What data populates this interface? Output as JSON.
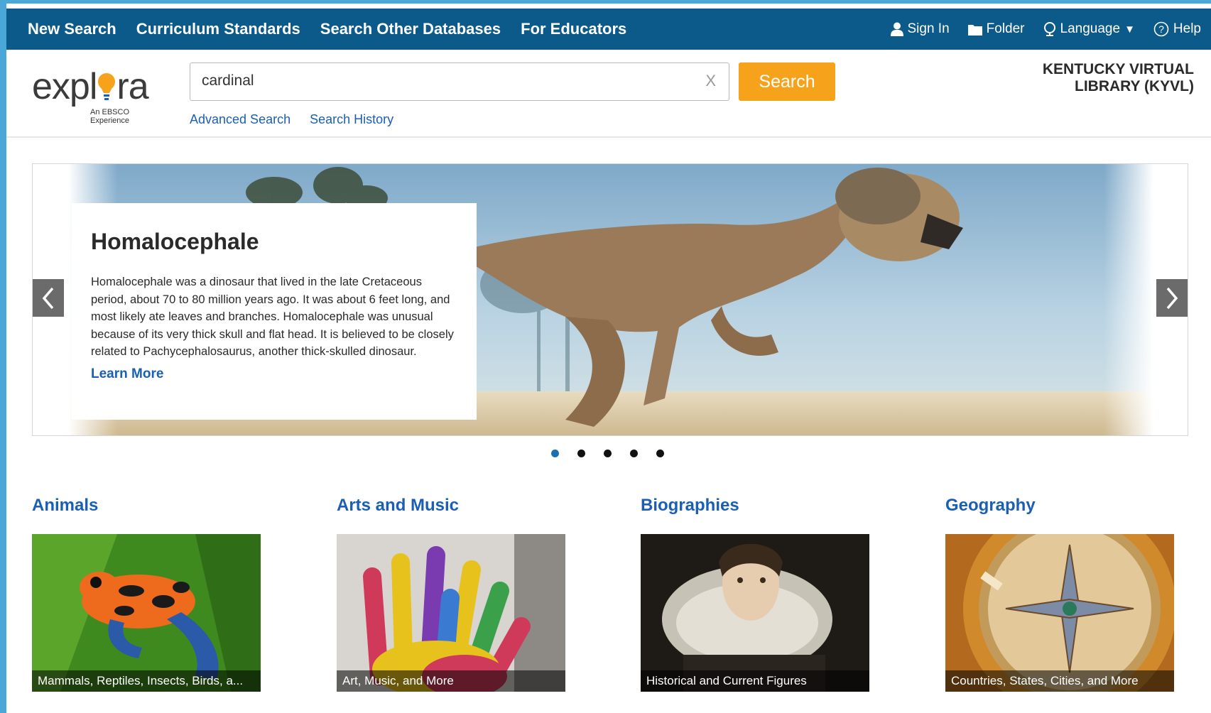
{
  "nav": {
    "links": [
      "New Search",
      "Curriculum Standards",
      "Search Other Databases",
      "For Educators"
    ],
    "sign_in": "Sign In",
    "folder": "Folder",
    "language": "Language",
    "help": "Help"
  },
  "brand": {
    "logo_prefix": "expl",
    "logo_suffix": "ra",
    "tagline": "An EBSCO Experience"
  },
  "search": {
    "query": "cardinal",
    "clear_label": "X",
    "button_label": "Search",
    "advanced": "Advanced Search",
    "history": "Search History"
  },
  "library": {
    "line1": "KENTUCKY VIRTUAL",
    "line2": "LIBRARY (KYVL)"
  },
  "carousel": {
    "title": "Homalocephale",
    "description": "Homalocephale was a dinosaur that lived in the late Cretaceous period, about 70 to 80 million years ago. It was about 6 feet long, and most likely ate leaves and branches. Homalocephale was unusual because of its very thick skull and flat head. It is believed to be closely related to Pachycephalosaurus, another thick-skulled dinosaur.",
    "link": "Learn More",
    "slide_count": 5,
    "active_slide": 1
  },
  "categories": [
    {
      "title": "Animals",
      "caption": "Mammals, Reptiles, Insects, Birds, a..."
    },
    {
      "title": "Arts and Music",
      "caption": "Art, Music, and More"
    },
    {
      "title": "Biographies",
      "caption": "Historical and Current Figures"
    },
    {
      "title": "Geography",
      "caption": "Countries, States, Cities, and More"
    }
  ],
  "colors": {
    "nav_bg": "#0b5a8a",
    "search_button": "#f7a21b",
    "link": "#1a5fb4",
    "frame": "#4aa8d8"
  }
}
